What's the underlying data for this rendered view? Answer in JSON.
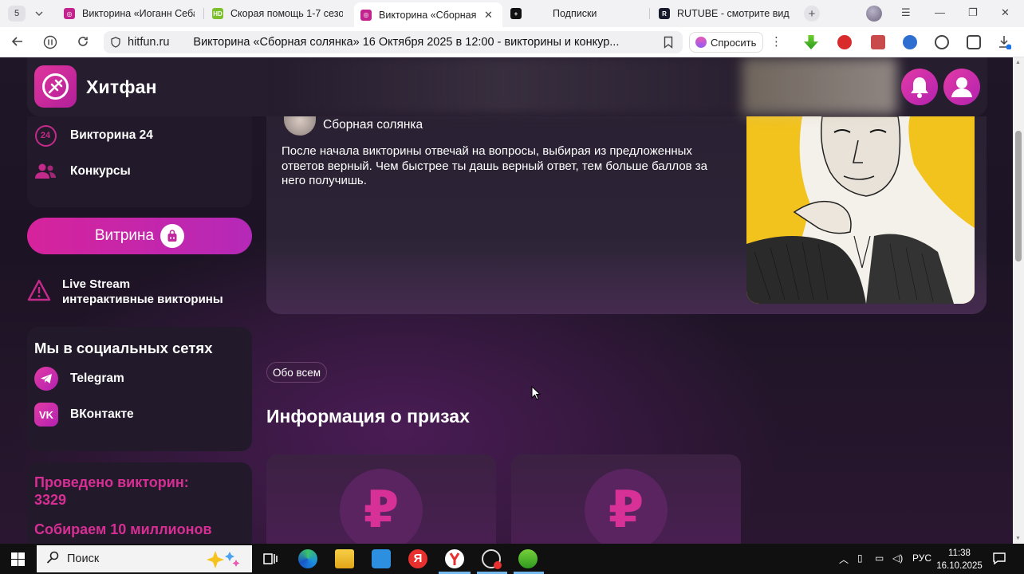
{
  "browser": {
    "tab_count": "5",
    "tabs": [
      {
        "title": "Викторина «Иоганн Себа",
        "favicon": "hitfun-favicon",
        "color": "#c2248d"
      },
      {
        "title": "Скорая помощь 1-7 сезо",
        "favicon": "hd-favicon",
        "color": "#7bbf2a"
      },
      {
        "title": "Викторина «Сборная с",
        "favicon": "hitfun-favicon",
        "color": "#c2248d",
        "active": true
      },
      {
        "title": "Подписки",
        "favicon": "plus-favicon",
        "color": "#111111"
      },
      {
        "title": "RUTUBE - смотрите виде",
        "favicon": "rutube-favicon",
        "color": "#161a2c"
      }
    ],
    "domain": "hitfun.ru",
    "page_title": "Викторина «Сборная солянка» 16 Октября 2025 в 12:00 - викторины и конкур...",
    "ask_label": "Спросить"
  },
  "site": {
    "brand": "Хитфан",
    "accent": "#d6239c"
  },
  "sidebar": {
    "items": [
      {
        "label": "Викторина 24",
        "badge": "24",
        "icon": "quiz24-icon"
      },
      {
        "label": "Конкурсы",
        "icon": "people-icon"
      }
    ],
    "vitrina_label": "Витрина",
    "live": {
      "line1": "Live Stream",
      "line2": "интерактивные викторины"
    },
    "social": {
      "title": "Мы в социальных сетях",
      "items": [
        {
          "label": "Telegram",
          "icon": "telegram-icon"
        },
        {
          "label": "ВКонтакте",
          "icon": "vk-icon"
        }
      ]
    },
    "stats": {
      "line1": "Проведено викторин:",
      "line2": "3329",
      "line3": "Собираем 10 миллионов"
    }
  },
  "hero": {
    "author": "Сборная солянка",
    "description": "После начала викторины отвечай на вопросы, выбирая из предложенных ответов верный. Чем быстрее ты дашь верный ответ, тем больше баллов за него получишь."
  },
  "content": {
    "tag": "Обо всем",
    "section_title": "Информация о призах",
    "prizes": [
      {
        "symbol": "₽"
      },
      {
        "symbol": "₽"
      }
    ]
  },
  "taskbar": {
    "search_placeholder": "Поиск",
    "lang": "РУС",
    "time": "11:38",
    "date": "16.10.2025"
  }
}
